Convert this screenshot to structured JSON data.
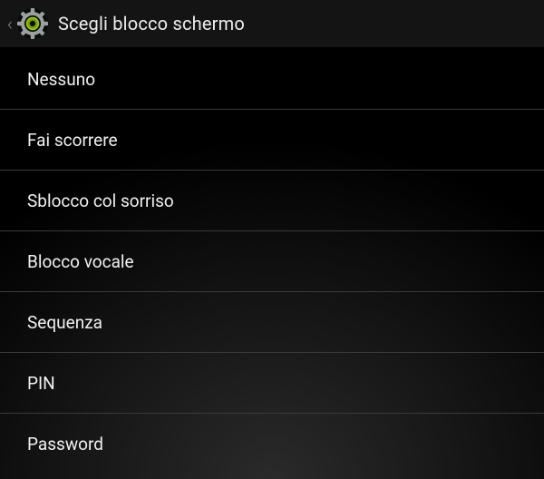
{
  "header": {
    "title": "Scegli blocco schermo"
  },
  "options": [
    {
      "label": "Nessuno"
    },
    {
      "label": "Fai scorrere"
    },
    {
      "label": "Sblocco col sorriso"
    },
    {
      "label": "Blocco vocale"
    },
    {
      "label": "Sequenza"
    },
    {
      "label": "PIN"
    },
    {
      "label": "Password"
    }
  ]
}
